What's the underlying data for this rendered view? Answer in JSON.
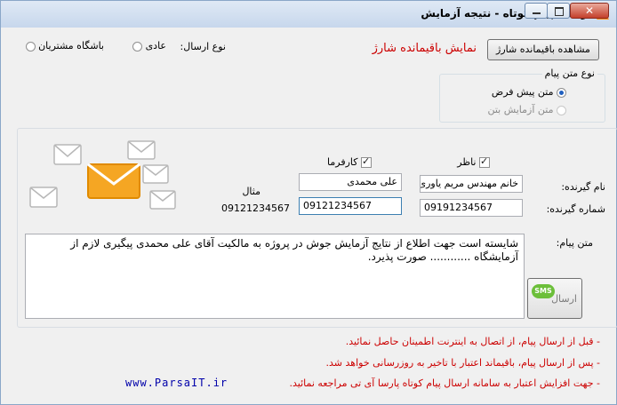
{
  "window": {
    "title": "ارسال پیام کوتاه  -  نتیجه آزمایش",
    "close_symbol": "✕"
  },
  "top": {
    "show_balance_button": "مشاهده باقیمانده شارژ",
    "balance_label": "نمایش باقیمانده شارژ",
    "send_type_label": "نوع ارسال:",
    "send_type_options": [
      "عادی",
      "باشگاه مشتریان"
    ]
  },
  "message_type": {
    "legend": "نوع متن پیام",
    "options": [
      "متن پیش فرض",
      "متن آزمایش بتن"
    ],
    "selected": "متن پیش فرض"
  },
  "recipients": {
    "name_label": "نام گیرنده:",
    "number_label": "شماره گیرنده:",
    "example_label": "مثال",
    "example_number": "09121234567",
    "supervisor_label": "ناظر",
    "employer_label": "کارفرما",
    "supervisor_name": "خانم مهندس مریم  یاوری",
    "employer_name": "علی محمدی",
    "supervisor_number": "09191234567",
    "employer_number": "09121234567"
  },
  "message": {
    "label": "متن پیام:",
    "text": "شایسته است جهت اطلاع از نتایج آزمایش جوش در پروژه به مالکیت آقای علی محمدی پیگیری لازم از آزمایشگاه   ............  صورت پذیرد.",
    "send_label": "ارسال",
    "sms_badge": "SMS"
  },
  "notes": [
    "- قبل از ارسال پیام، از اتصال به اینترنت اطمینان حاصل نمائید.",
    "- پس از ارسال پیام، باقیماند اعتبار با تاخیر به روزرسانی خواهد شد.",
    "- جهت افزایش اعتبار به سامانه  ارسال پیام کوتاه پارسا آی تی مراجعه نمائید."
  ],
  "website": "www.ParsaIT.ir",
  "colors": {
    "accent_red": "#cc0000",
    "link_blue": "#0000aa",
    "envelope_orange": "#f5a623"
  }
}
